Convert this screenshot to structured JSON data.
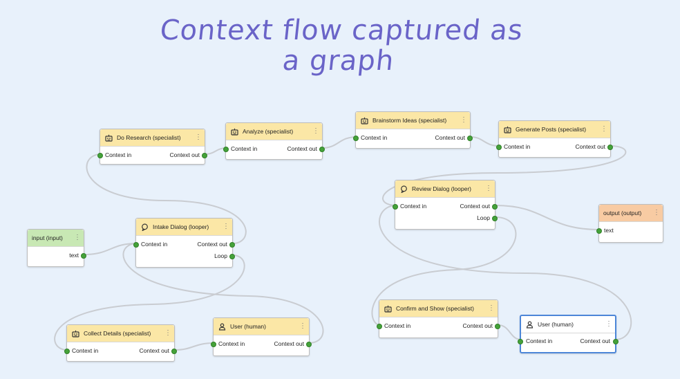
{
  "title_lines": [
    "Context flow captured as",
    "a graph"
  ],
  "nodes": {
    "research": {
      "title": "Do Research (specialist)",
      "in": "Context in",
      "out": "Context out"
    },
    "analyze": {
      "title": "Analyze (specialist)",
      "in": "Context in",
      "out": "Context out"
    },
    "brainstorm": {
      "title": "Brainstorm Ideas (specialist)",
      "in": "Context in",
      "out": "Context out"
    },
    "generate": {
      "title": "Generate Posts (specialist)",
      "in": "Context in",
      "out": "Context out"
    },
    "review": {
      "title": "Review Dialog (looper)",
      "in": "Context in",
      "out": "Context out",
      "loop": "Loop"
    },
    "output": {
      "title": "output (output)",
      "in": "text"
    },
    "input": {
      "title": "input (input)",
      "out": "text"
    },
    "intake": {
      "title": "Intake Dialog (looper)",
      "in": "Context in",
      "out": "Context out",
      "loop": "Loop"
    },
    "confirm": {
      "title": "Confirm and Show (specialist)",
      "in": "Context in",
      "out": "Context out"
    },
    "user2": {
      "title": "User (human)",
      "in": "Context in",
      "out": "Context out"
    },
    "collect": {
      "title": "Collect Details (specialist)",
      "in": "Context in",
      "out": "Context out"
    },
    "user1": {
      "title": "User (human)",
      "in": "Context in",
      "out": "Context out"
    }
  },
  "icons": {
    "specialist": "robot-icon",
    "looper": "loop-icon",
    "human": "person-icon",
    "menu": "more-vertical-icon"
  },
  "colors": {
    "title": "#6a64c8",
    "header_specialist": "#fbe7a6",
    "header_input": "#c8e8b4",
    "header_output": "#f8cba3",
    "port": "#45a23a",
    "wire": "#c9ccd1",
    "selected_border": "#4c86d8"
  }
}
